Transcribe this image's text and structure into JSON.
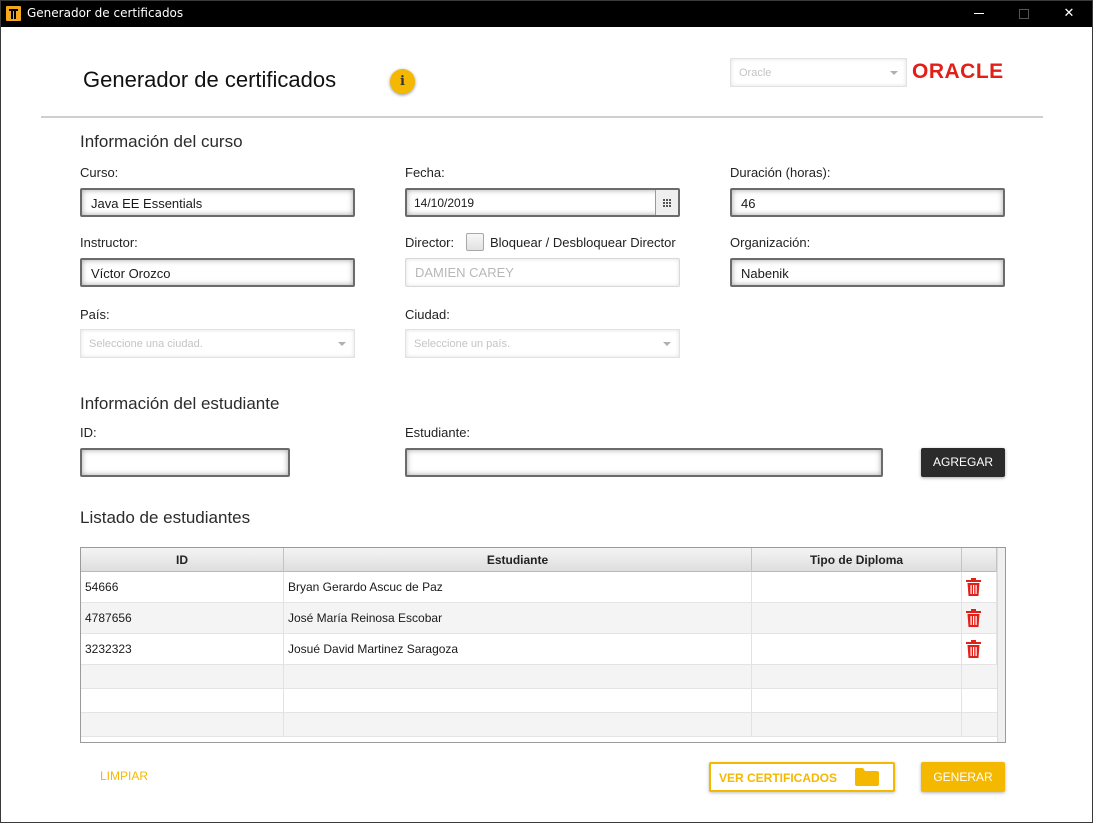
{
  "window": {
    "title": "Generador de certificados",
    "minimize_label": "",
    "close_label": "✕"
  },
  "header": {
    "title": "Generador de certificados",
    "info_icon": "i",
    "provider_select": {
      "placeholder": "Oracle"
    },
    "logo_text": "ORACLE"
  },
  "course": {
    "section_title": "Información del curso",
    "curso": {
      "label": "Curso:",
      "value": "Java EE Essentials"
    },
    "fecha": {
      "label": "Fecha:",
      "value": "14/10/2019"
    },
    "duracion": {
      "label": "Duración (horas):",
      "value": "46"
    },
    "instructor": {
      "label": "Instructor:",
      "value": "Víctor Orozco"
    },
    "director": {
      "label": "Director:",
      "checkbox_label": "Bloquear / Desbloquear Director",
      "value": "DAMIEN CAREY"
    },
    "organizacion": {
      "label": "Organización:",
      "value": "Nabenik"
    },
    "pais": {
      "label": "País:",
      "placeholder": "Seleccione una ciudad."
    },
    "ciudad": {
      "label": "Ciudad:",
      "placeholder": "Seleccione un país."
    }
  },
  "student": {
    "section_title": "Información del estudiante",
    "id": {
      "label": "ID:",
      "value": ""
    },
    "estudiante": {
      "label": "Estudiante:",
      "value": ""
    },
    "add_button": "AGREGAR"
  },
  "list": {
    "section_title": "Listado de estudiantes",
    "columns": [
      "ID",
      "Estudiante",
      "Tipo de Diploma"
    ],
    "rows": [
      {
        "id": "54666",
        "name": "Bryan Gerardo Ascuc de Paz",
        "diploma": ""
      },
      {
        "id": "4787656",
        "name": "José María Reinosa Escobar",
        "diploma": ""
      },
      {
        "id": "3232323",
        "name": "Josué David Martinez Saragoza",
        "diploma": ""
      }
    ],
    "delete_icon": "trash-icon"
  },
  "footer": {
    "clear_button": "LIMPIAR",
    "view_button": "VER CERTIFICADOS",
    "generate_button": "GENERAR"
  },
  "colors": {
    "accent": "#f5b800",
    "danger": "#e2201a",
    "dark_button": "#2b2b2b"
  }
}
